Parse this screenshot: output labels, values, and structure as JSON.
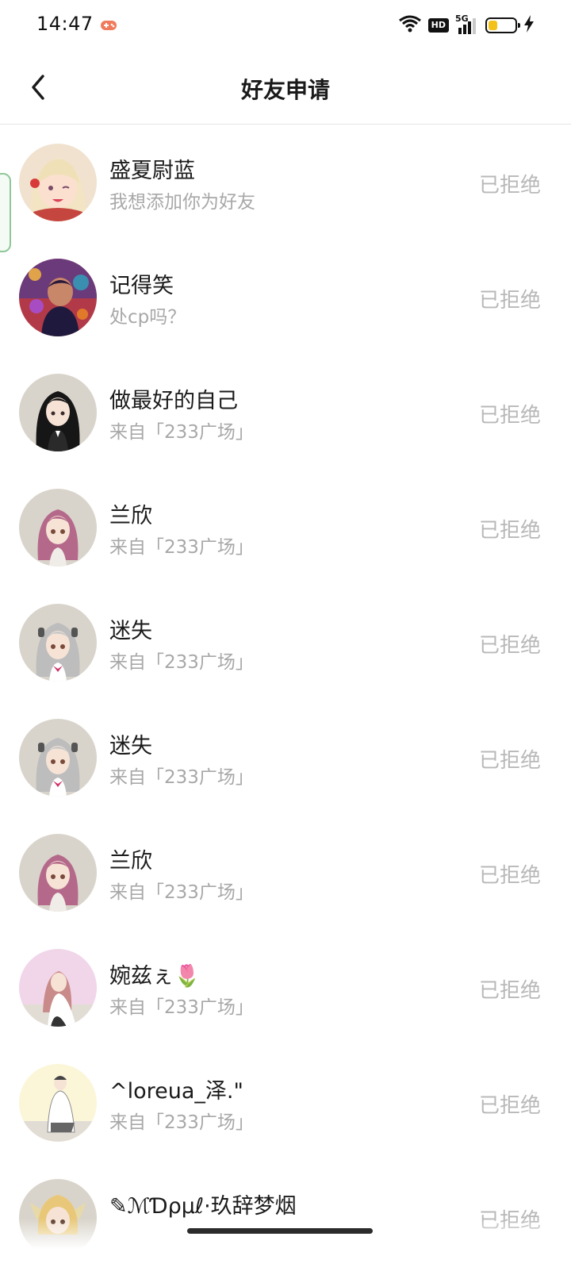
{
  "status_bar": {
    "time": "14:47",
    "icons": [
      "game-controller-icon",
      "wifi-icon",
      "hd-icon",
      "signal-5g-icon",
      "battery-icon",
      "charging-icon"
    ],
    "hd_label": "HD",
    "network_label": "5G",
    "battery_level": 0.35,
    "battery_color": "#f3c21a"
  },
  "header": {
    "title": "好友申请",
    "back_icon": "chevron-left-icon"
  },
  "requests": [
    {
      "name": "盛夏尉蓝",
      "message": "我想添加你为好友",
      "status": "已拒绝",
      "avatar_bg": "#f0e2cf"
    },
    {
      "name": "记得笑",
      "message": "处cp吗？",
      "status": "已拒绝",
      "avatar_bg": "#b23a48"
    },
    {
      "name": "做最好的自己",
      "message": "来自「233广场」",
      "status": "已拒绝",
      "avatar_bg": "#d9d4cb"
    },
    {
      "name": "兰欣",
      "message": "来自「233广场」",
      "status": "已拒绝",
      "avatar_bg": "#d9d4cb"
    },
    {
      "name": "迷失",
      "message": "来自「233广场」",
      "status": "已拒绝",
      "avatar_bg": "#d9d4cb"
    },
    {
      "name": "迷失",
      "message": "来自「233广场」",
      "status": "已拒绝",
      "avatar_bg": "#d9d4cb"
    },
    {
      "name": "兰欣",
      "message": "来自「233广场」",
      "status": "已拒绝",
      "avatar_bg": "#d9d4cb"
    },
    {
      "name": "婉兹ぇ🌷",
      "message": "来自「233广场」",
      "status": "已拒绝",
      "avatar_bg": "#f1d6ea"
    },
    {
      "name": "^loreua_泽.\"",
      "message": "来自「233广场」",
      "status": "已拒绝",
      "avatar_bg": "#fbf6d8"
    },
    {
      "name": "✎ℳƊρμℓ·玖辞梦烟",
      "message": "",
      "status": "已拒绝",
      "avatar_bg": "#d9d4cb"
    }
  ]
}
